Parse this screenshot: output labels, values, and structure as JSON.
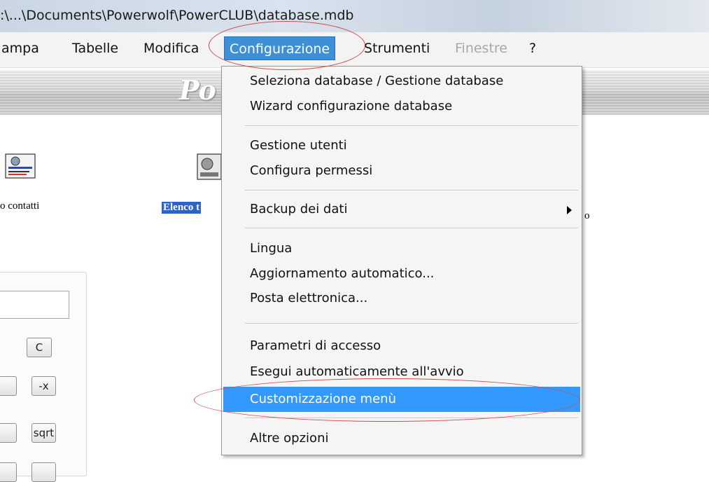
{
  "window": {
    "title": ":\\...\\Documents\\Powerwolf\\PowerCLUB\\database.mdb"
  },
  "menubar": {
    "items": [
      {
        "label": "ampa",
        "state": "normal"
      },
      {
        "label": "Tabelle",
        "state": "normal"
      },
      {
        "label": "Modifica",
        "state": "normal"
      },
      {
        "label": "Configurazione",
        "state": "active"
      },
      {
        "label": "Strumenti",
        "state": "normal"
      },
      {
        "label": "Finestre",
        "state": "disabled"
      },
      {
        "label": "?",
        "state": "normal"
      }
    ]
  },
  "banner": {
    "title": "Po"
  },
  "desktop": {
    "icons": [
      {
        "label": "o contatti",
        "selected": false
      },
      {
        "label": "Elenco t",
        "selected": true
      }
    ],
    "right_label": "o"
  },
  "calculator": {
    "buttons": [
      "C",
      "",
      "-x",
      "",
      "sqrt"
    ]
  },
  "dropdown": {
    "items": [
      {
        "label": "Seleziona database / Gestione database"
      },
      {
        "label": "Wizard configurazione database"
      },
      {
        "label": "Gestione utenti"
      },
      {
        "label": "Configura permessi"
      },
      {
        "label": "Backup dei dati",
        "submenu": true
      },
      {
        "label": "Lingua"
      },
      {
        "label": "Aggiornamento automatico..."
      },
      {
        "label": "Posta elettronica..."
      },
      {
        "label": "Parametri di accesso"
      },
      {
        "label": "Esegui automaticamente all'avvio"
      },
      {
        "label": "Customizzazione menù",
        "highlighted": true
      },
      {
        "label": "Altre opzioni"
      }
    ]
  },
  "colors": {
    "highlight": "#3399ff",
    "annotation": "#d24a4a",
    "selection": "#2e62c4"
  }
}
